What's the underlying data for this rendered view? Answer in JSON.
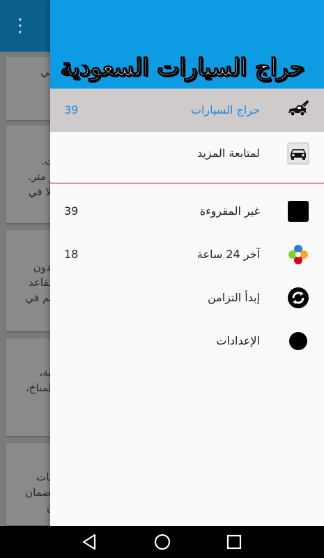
{
  "background": {
    "overflow_icon": "⋮",
    "cards": [
      {
        "lines": [
          "في"
        ]
      },
      {
        "lines": [
          "ت.",
          "ر متر.",
          "إلا في"
        ]
      },
      {
        "lines": [
          "بدون",
          "مقاعد",
          "كم في"
        ]
      },
      {
        "lines": [
          "بية،",
          "المناخ،",
          "،"
        ]
      },
      {
        "lines": [
          "فات",
          "لضمان",
          "ن"
        ]
      }
    ]
  },
  "drawer": {
    "header_title": "حراج السيارات السعودية",
    "primary": [
      {
        "label": "حراج السيارات",
        "count": "39",
        "icon": "tow-truck-icon",
        "active": true
      },
      {
        "label": "لمتابعة المزيد",
        "count": "",
        "icon": "car-icon",
        "active": false
      }
    ],
    "secondary": [
      {
        "label": "غير المقروءة",
        "count": "39",
        "icon": "black-square-icon"
      },
      {
        "label": "آخر 24 ساعة",
        "count": "18",
        "icon": "colorful-flower-icon"
      },
      {
        "label": "إبدأ التزامن",
        "count": "",
        "icon": "sync-icon"
      },
      {
        "label": "الإعدادات",
        "count": "",
        "icon": "black-circle-icon"
      }
    ]
  },
  "navbar": {
    "back_icon": "back-triangle-icon",
    "home_icon": "home-circle-icon",
    "recents_icon": "recents-square-icon"
  },
  "colors": {
    "header": "#0d9be3",
    "active_row": "#cfcbcb",
    "active_text": "#1e88e5",
    "divider": "#d0021b"
  }
}
